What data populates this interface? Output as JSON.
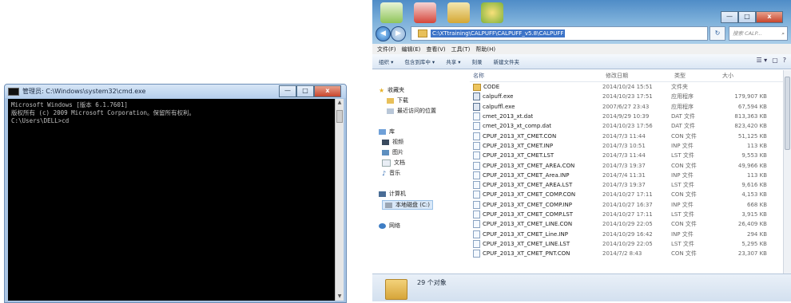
{
  "cmd": {
    "title": "管理员: C:\\Windows\\system32\\cmd.exe",
    "lines": [
      "Microsoft Windows [版本 6.1.7601]",
      "版权所有 (c) 2009 Microsoft Corporation。保留所有权利。",
      "",
      "C:\\Users\\DELL>cd"
    ],
    "controls": {
      "minimize": "—",
      "maximize": "□",
      "close": "x"
    }
  },
  "explorer": {
    "address": "C:\\XTtraining\\CALPUFF\\CALPUFF_v5.8\\CALPUFF",
    "search_placeholder": "搜索 CALP...",
    "menu": [
      "文件(F)",
      "编辑(E)",
      "查看(V)",
      "工具(T)",
      "帮助(H)"
    ],
    "toolbar": [
      "组织 ▾",
      "包含到库中 ▾",
      "共享 ▾",
      "刻录",
      "新建文件夹"
    ],
    "nav": {
      "favorites": "收藏夹",
      "downloads": "下载",
      "recent": "最近访问的位置",
      "libraries": "库",
      "videos": "视频",
      "pictures": "图片",
      "documents": "文档",
      "music": "音乐",
      "computer": "计算机",
      "local_disk": "本地磁盘 (C:)",
      "network": "网络"
    },
    "columns": {
      "name": "名称",
      "date": "修改日期",
      "type": "类型",
      "size": "大小"
    },
    "files": [
      {
        "name": "CODE",
        "date": "2014/10/24 15:51",
        "type": "文件夹",
        "size": "",
        "kind": "folder"
      },
      {
        "name": "calpuff.exe",
        "date": "2014/10/23 17:51",
        "type": "应用程序",
        "size": "179,907 KB",
        "kind": "exe"
      },
      {
        "name": "calpuffl.exe",
        "date": "2007/6/27 23:43",
        "type": "应用程序",
        "size": "67,594 KB",
        "kind": "exe"
      },
      {
        "name": "cmet_2013_xt.dat",
        "date": "2014/9/29 10:39",
        "type": "DAT 文件",
        "size": "813,363 KB",
        "kind": "file"
      },
      {
        "name": "cmet_2013_xt_comp.dat",
        "date": "2014/10/23 17:56",
        "type": "DAT 文件",
        "size": "823,420 KB",
        "kind": "file"
      },
      {
        "name": "CPUF_2013_XT_CMET.CON",
        "date": "2014/7/3 11:44",
        "type": "CON 文件",
        "size": "51,125 KB",
        "kind": "file"
      },
      {
        "name": "CPUF_2013_XT_CMET.INP",
        "date": "2014/7/3 10:51",
        "type": "INP 文件",
        "size": "113 KB",
        "kind": "file"
      },
      {
        "name": "CPUF_2013_XT_CMET.LST",
        "date": "2014/7/3 11:44",
        "type": "LST 文件",
        "size": "9,553 KB",
        "kind": "file"
      },
      {
        "name": "CPUF_2013_XT_CMET_AREA.CON",
        "date": "2014/7/3 19:37",
        "type": "CON 文件",
        "size": "49,966 KB",
        "kind": "file"
      },
      {
        "name": "CPUF_2013_XT_CMET_Area.INP",
        "date": "2014/7/4 11:31",
        "type": "INP 文件",
        "size": "113 KB",
        "kind": "file"
      },
      {
        "name": "CPUF_2013_XT_CMET_AREA.LST",
        "date": "2014/7/3 19:37",
        "type": "LST 文件",
        "size": "9,616 KB",
        "kind": "file"
      },
      {
        "name": "CPUF_2013_XT_CMET_COMP.CON",
        "date": "2014/10/27 17:11",
        "type": "CON 文件",
        "size": "4,153 KB",
        "kind": "file"
      },
      {
        "name": "CPUF_2013_XT_CMET_COMP.INP",
        "date": "2014/10/27 16:37",
        "type": "INP 文件",
        "size": "668 KB",
        "kind": "file"
      },
      {
        "name": "CPUF_2013_XT_CMET_COMP.LST",
        "date": "2014/10/27 17:11",
        "type": "LST 文件",
        "size": "3,915 KB",
        "kind": "file"
      },
      {
        "name": "CPUF_2013_XT_CMET_LINE.CON",
        "date": "2014/10/29 22:05",
        "type": "CON 文件",
        "size": "26,409 KB",
        "kind": "file"
      },
      {
        "name": "CPUF_2013_XT_CMET_Line.INP",
        "date": "2014/10/29 16:42",
        "type": "INP 文件",
        "size": "294 KB",
        "kind": "file"
      },
      {
        "name": "CPUF_2013_XT_CMET_LINE.LST",
        "date": "2014/10/29 22:05",
        "type": "LST 文件",
        "size": "5,295 KB",
        "kind": "file"
      },
      {
        "name": "CPUF_2013_XT_CMET_PNT.CON",
        "date": "2014/7/2 8:43",
        "type": "CON 文件",
        "size": "23,307 KB",
        "kind": "file"
      }
    ],
    "status_count": "29 个对象"
  }
}
